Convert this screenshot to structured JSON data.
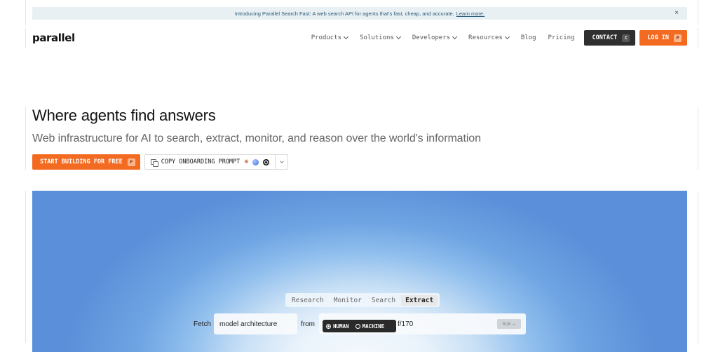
{
  "announcement": {
    "text": "Introducing Parallel Search Fast: A web search API for agents that's fast, cheap, and accurate.",
    "link": "Learn more.",
    "close": "×"
  },
  "nav": {
    "logo": "parallel",
    "items": [
      "Products",
      "Solutions",
      "Developers",
      "Resources",
      "Blog",
      "Pricing"
    ],
    "contact": {
      "label": "CONTACT",
      "key": "C"
    },
    "login": {
      "label": "LOG IN",
      "key": "P"
    }
  },
  "hero": {
    "title": "Where agents find answers",
    "subtitle": "Web infrastructure for AI to search, extract, monitor, and reason over the world's information",
    "start": {
      "label": "START BUILDING FOR FREE",
      "key": "P"
    },
    "copy": {
      "label": "COPY ONBOARDING PROMPT"
    }
  },
  "demo": {
    "tabs": [
      "Research",
      "Monitor",
      "Search",
      "Extract"
    ],
    "active_tab": "Extract",
    "fetch_label": "Fetch",
    "fetch_value": "model architecture",
    "from_label": "from",
    "url_value": "f/170",
    "toggle": {
      "human": "HUMAN",
      "machine": "MACHINE"
    },
    "run": {
      "label": "RUN",
      "key": "↵"
    }
  },
  "colors": {
    "accent": "#f36b21",
    "dark": "#2f2f2f",
    "panel_blue": "#5b8fd9"
  }
}
